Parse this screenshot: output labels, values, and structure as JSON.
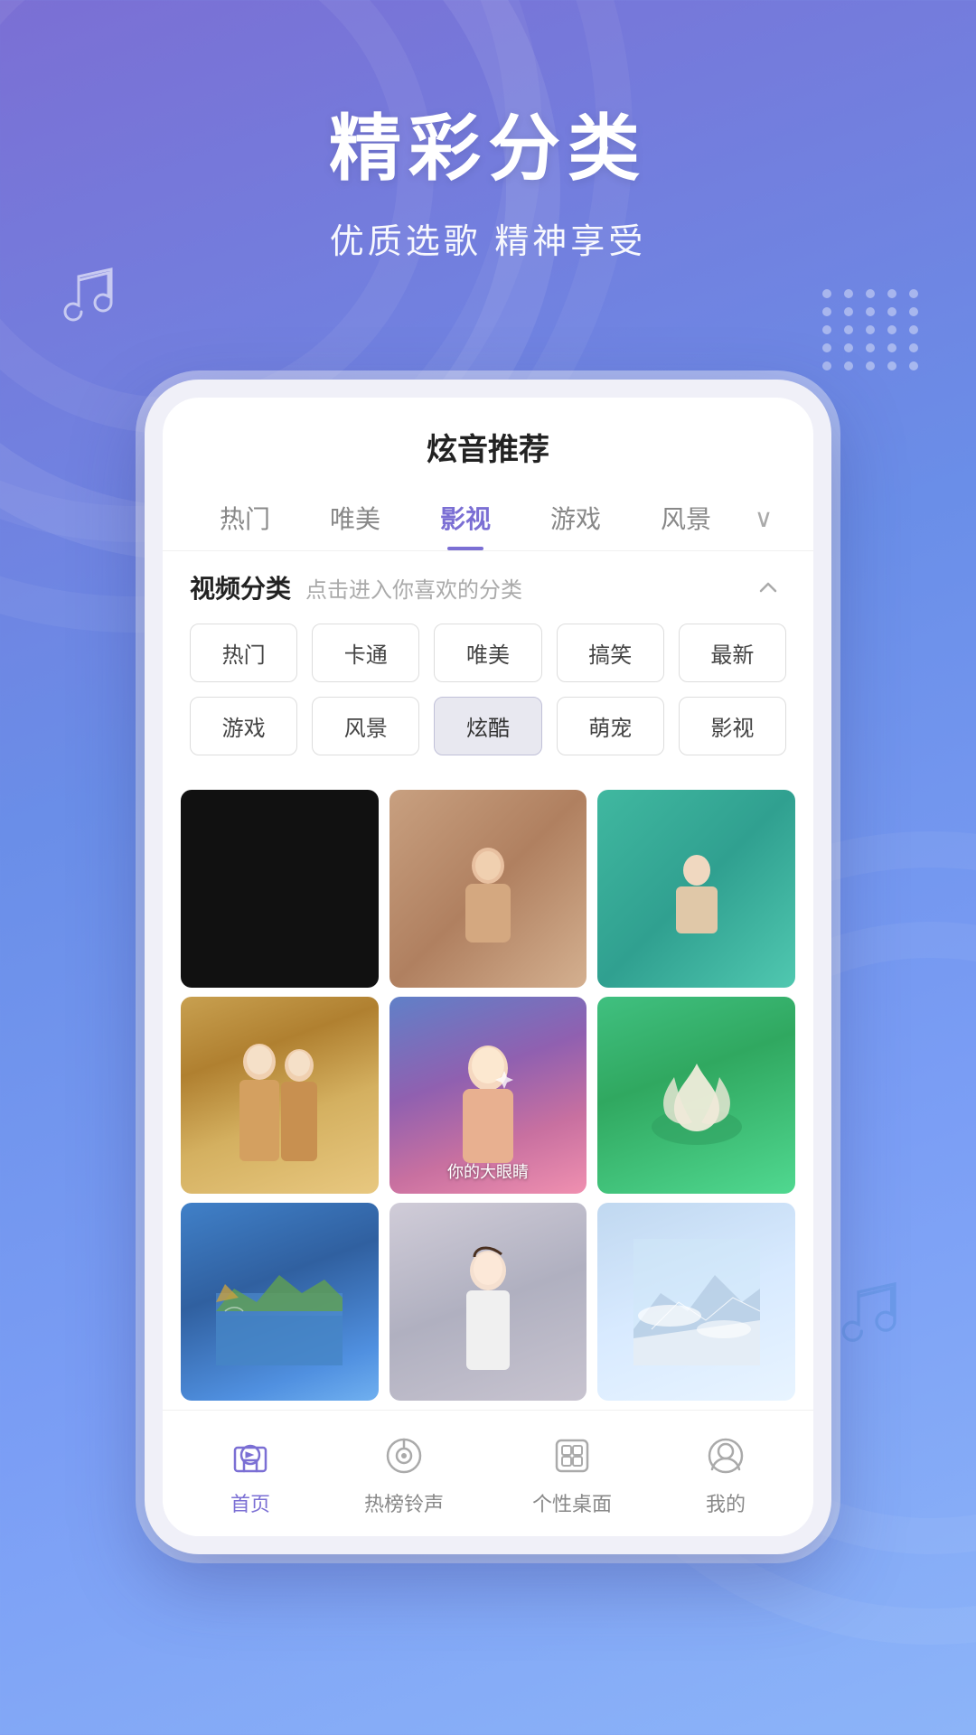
{
  "app": {
    "background_gradient": "linear-gradient(160deg, #7b6fd4, #6a8ee8, #7b9ef5)",
    "header": {
      "title": "精彩分类",
      "subtitle": "优质选歌 精神享受"
    },
    "phone": {
      "app_name": "炫音推荐",
      "tabs": [
        {
          "label": "热门",
          "active": false
        },
        {
          "label": "唯美",
          "active": false
        },
        {
          "label": "影视",
          "active": true
        },
        {
          "label": "游戏",
          "active": false
        },
        {
          "label": "风景",
          "active": false
        }
      ],
      "category_section": {
        "title": "视频分类",
        "hint": "点击进入你喜欢的分类"
      },
      "tags_row1": [
        "热门",
        "卡通",
        "唯美",
        "搞笑",
        "最新"
      ],
      "tags_row2": [
        "游戏",
        "风景",
        "炫酷",
        "萌宠",
        "影视"
      ],
      "selected_tag": "炫酷",
      "videos": [
        {
          "id": 1,
          "style": "dark"
        },
        {
          "id": 2,
          "style": "warm-body"
        },
        {
          "id": 3,
          "style": "teal"
        },
        {
          "id": 4,
          "style": "girls-traditional"
        },
        {
          "id": 5,
          "style": "girls-selfie",
          "overlay": "你的大眼睛"
        },
        {
          "id": 6,
          "style": "lotus"
        },
        {
          "id": 7,
          "style": "mountain-lake"
        },
        {
          "id": 8,
          "style": "girl-white"
        },
        {
          "id": 9,
          "style": "misty-mountain"
        }
      ],
      "bottom_nav": [
        {
          "label": "首页",
          "icon": "home",
          "active": true
        },
        {
          "label": "热榜铃声",
          "icon": "ringtone",
          "active": false
        },
        {
          "label": "个性桌面",
          "icon": "desktop",
          "active": false
        },
        {
          "label": "我的",
          "icon": "profile",
          "active": false
        }
      ]
    }
  }
}
